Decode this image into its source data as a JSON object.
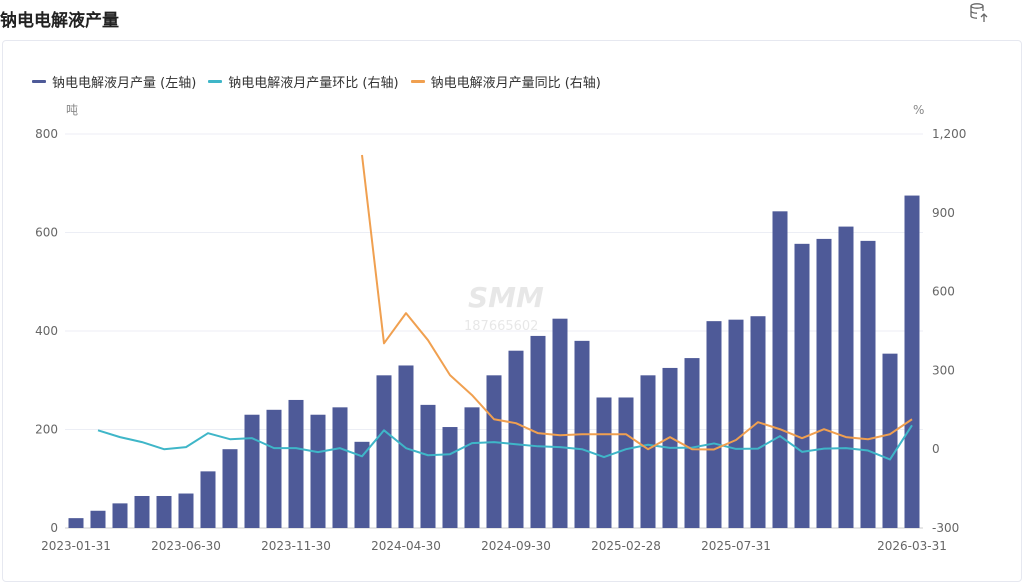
{
  "title": "钠电电解液产量",
  "icons": {
    "export": "database-export-icon"
  },
  "watermark": {
    "logo": "SMM",
    "number": "187665602"
  },
  "chart_data": {
    "type": "bar",
    "title": "",
    "legend_position": "top-left",
    "grid": true,
    "y_left": {
      "unit": "吨",
      "range": [
        0,
        800
      ],
      "ticks": [
        "0",
        "200",
        "400",
        "600",
        "800"
      ]
    },
    "y_right": {
      "unit": "%",
      "range": [
        -300,
        1200
      ],
      "ticks": [
        "-300",
        "0",
        "300",
        "600",
        "900",
        "1,200"
      ]
    },
    "x_tick_labels": [
      "2023-01-31",
      "2023-06-30",
      "2023-11-30",
      "2024-04-30",
      "2024-09-30",
      "2025-02-28",
      "2025-07-31",
      "2026-03-31"
    ],
    "x_tick_indices": [
      0,
      5,
      10,
      15,
      20,
      25,
      30,
      38
    ],
    "categories": [
      "2023-01",
      "2023-02",
      "2023-03",
      "2023-04",
      "2023-05",
      "2023-06",
      "2023-07",
      "2023-08",
      "2023-09",
      "2023-10",
      "2023-11",
      "2023-12",
      "2024-01",
      "2024-02",
      "2024-03",
      "2024-04",
      "2024-05",
      "2024-06",
      "2024-07",
      "2024-08",
      "2024-09",
      "2024-10",
      "2024-11",
      "2024-12",
      "2025-01",
      "2025-02",
      "2025-03",
      "2025-04",
      "2025-05",
      "2025-06",
      "2025-07",
      "2025-08",
      "2025-09",
      "2025-10",
      "2025-11",
      "2025-12",
      "2026-01",
      "2026-02",
      "2026-03"
    ],
    "series": [
      {
        "name": "钠电电解液月产量 (左轴)",
        "type": "bar",
        "axis": "left",
        "color": "#4e5a98",
        "values": [
          20,
          35,
          50,
          65,
          65,
          70,
          115,
          160,
          230,
          240,
          260,
          230,
          245,
          175,
          310,
          330,
          250,
          205,
          245,
          310,
          360,
          390,
          425,
          380,
          265,
          265,
          310,
          325,
          345,
          420,
          423,
          430,
          643,
          577,
          587,
          612,
          583,
          354,
          675
        ]
      },
      {
        "name": "钠电电解液月产量环比 (右轴)",
        "type": "line",
        "axis": "right",
        "color": "#3fb6c8",
        "values": [
          null,
          72,
          46,
          27,
          0,
          8,
          61,
          38,
          42,
          4,
          4,
          -11,
          4,
          -27,
          72,
          4,
          -23,
          -19,
          23,
          27,
          19,
          11,
          8,
          0,
          -30,
          0,
          17,
          5,
          6,
          22,
          1,
          2,
          50,
          -10,
          2,
          4,
          -5,
          -39,
          91
        ]
      },
      {
        "name": "钠电电解液月产量同比 (右轴)",
        "type": "line",
        "axis": "right",
        "color": "#f0a050",
        "values": [
          null,
          null,
          null,
          null,
          null,
          null,
          null,
          null,
          null,
          null,
          null,
          null,
          null,
          1120,
          403,
          518,
          415,
          282,
          206,
          114,
          99,
          61,
          53,
          57,
          57,
          57,
          0,
          46,
          0,
          -1,
          35,
          103,
          76,
          42,
          76,
          46,
          38,
          57,
          114
        ]
      }
    ]
  }
}
